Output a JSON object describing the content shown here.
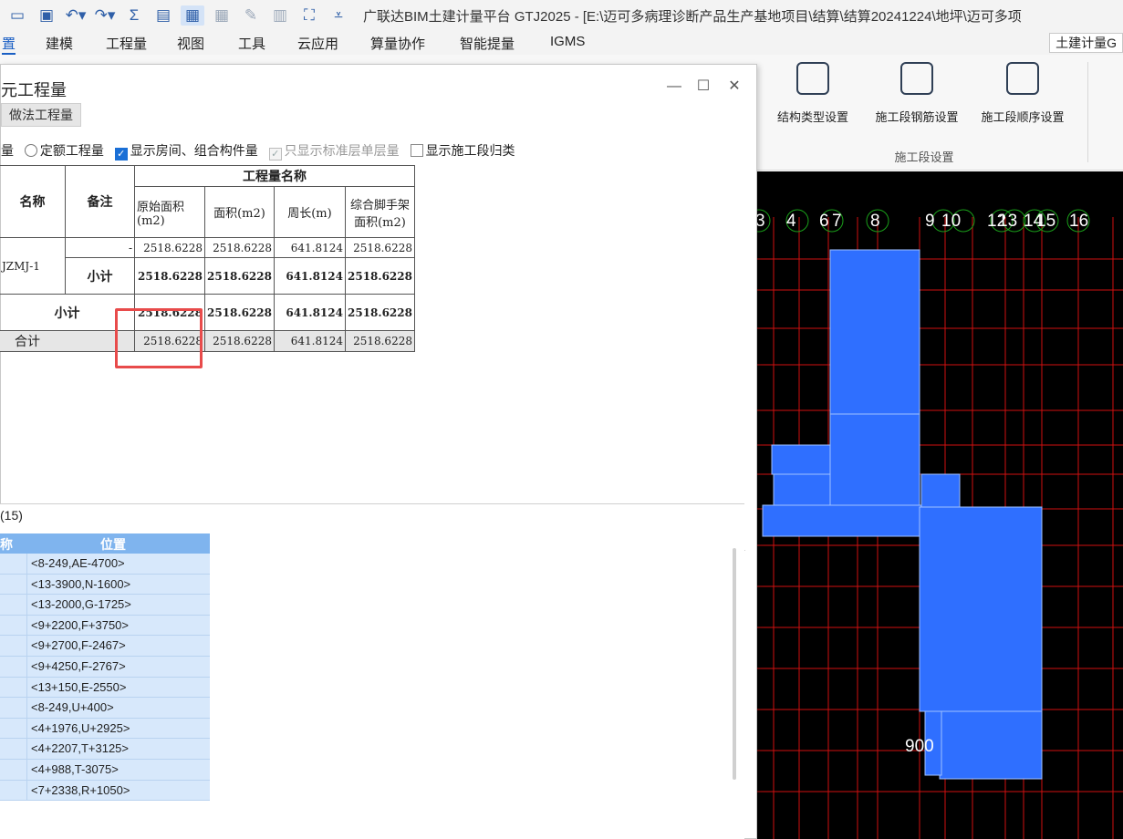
{
  "titlebar": {
    "title": "广联达BIM土建计量平台 GTJ2025 - [E:\\迈可多病理诊断产品生产基地项目\\结算\\结算20241224\\地坪\\迈可多项"
  },
  "menu": {
    "items": [
      "置",
      "建模",
      "工程量",
      "视图",
      "工具",
      "云应用",
      "算量协作",
      "智能提量",
      "IGMS"
    ],
    "right_tab": "土建计量G"
  },
  "ribbon": {
    "buttons": [
      "结构类型设置",
      "施工段钢筋设置",
      "施工段顺序设置"
    ],
    "group_label": "施工段设置"
  },
  "dialog": {
    "title": "元工程量",
    "tab": "做法工程量",
    "options": {
      "opt_a": "量",
      "opt_b": "定额工程量",
      "opt_c": "显示房间、组合构件量",
      "opt_d": "只显示标准层单层量",
      "opt_e": "显示施工段归类"
    },
    "table": {
      "col_name": "名称",
      "col_note": "备注",
      "group_header": "工程量名称",
      "col_q1": "原始面积(m2)",
      "col_q2": "面积(m2)",
      "col_q3": "周长(m)",
      "col_q4": "综合脚手架面积(m2)",
      "component": "JZMJ-1",
      "row1_note": "-",
      "row1": [
        "2518.6228",
        "2518.6228",
        "641.8124",
        "2518.6228"
      ],
      "sub_label": "小计",
      "row2": [
        "2518.6228",
        "2518.6228",
        "641.8124",
        "2518.6228"
      ],
      "row3": [
        "2518.6228",
        "2518.6228",
        "641.8124",
        "2518.6228"
      ],
      "total_label": "合计",
      "total": [
        "2518.6228",
        "2518.6228",
        "641.8124",
        "2518.6228"
      ]
    }
  },
  "lower": {
    "title": "(15)",
    "col_name": "称",
    "col_pos": "位置",
    "rows": [
      "<8-249,AE-4700>",
      "<13-3900,N-1600>",
      "<13-2000,G-1725>",
      "<9+2200,F+3750>",
      "<9+2700,F-2467>",
      "<9+4250,F-2767>",
      "<13+150,E-2550>",
      "<8-249,U+400>",
      "<4+1976,U+2925>",
      "<4+2207,T+3125>",
      "<4+988,T-3075>",
      "<7+2338,R+1050>"
    ]
  },
  "canvas": {
    "axis_labels": [
      "3",
      "4",
      "6",
      "7",
      "8",
      "9",
      "10",
      "12",
      "13",
      "14",
      "15",
      "16"
    ],
    "dimension": "900"
  }
}
